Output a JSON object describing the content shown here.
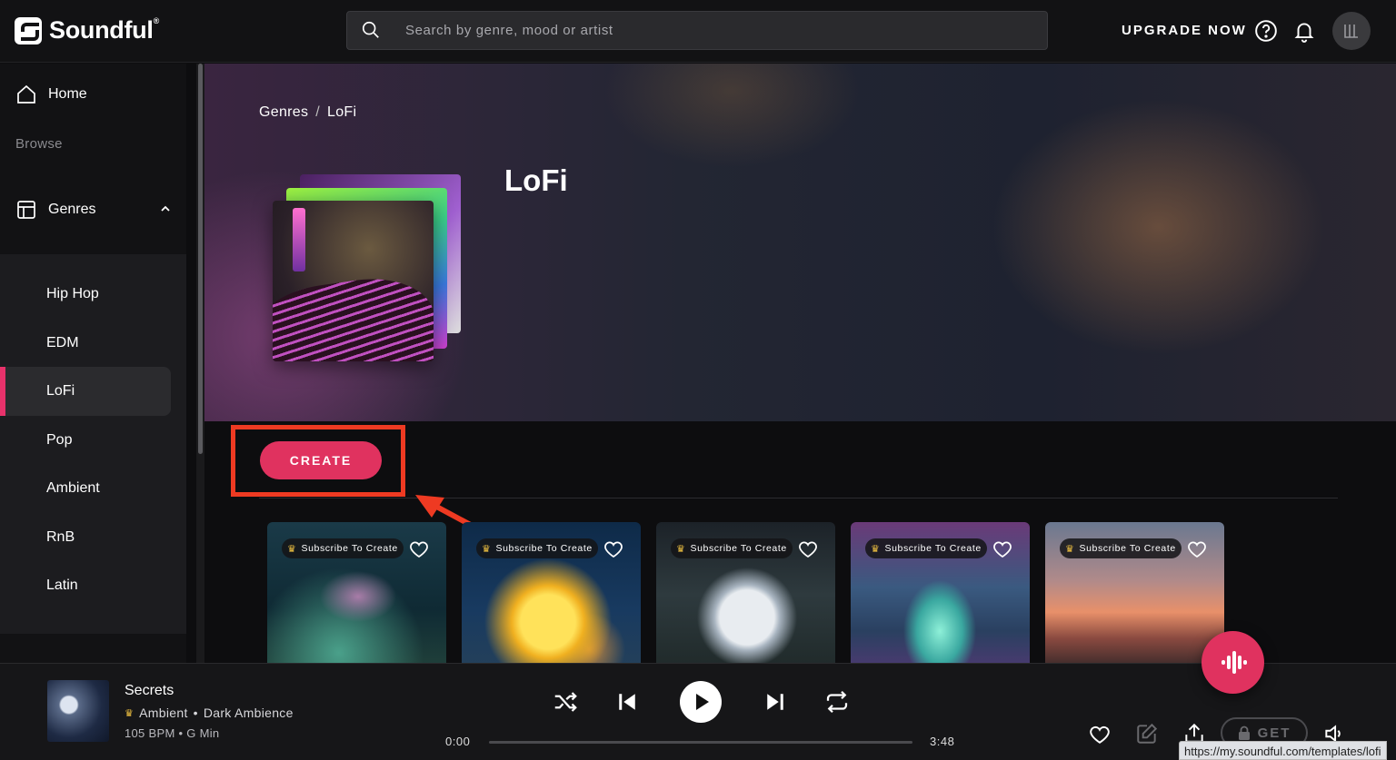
{
  "app": {
    "name": "Soundful"
  },
  "header": {
    "search_placeholder": "Search by genre, mood or artist",
    "upgrade_label": "UPGRADE NOW"
  },
  "sidebar": {
    "home_label": "Home",
    "browse_label": "Browse",
    "genres_label": "Genres",
    "genres": [
      {
        "label": "Hip Hop"
      },
      {
        "label": "EDM"
      },
      {
        "label": "LoFi",
        "active": true
      },
      {
        "label": "Pop"
      },
      {
        "label": "Ambient"
      },
      {
        "label": "RnB"
      },
      {
        "label": "Latin"
      }
    ]
  },
  "page": {
    "breadcrumb": {
      "root": "Genres",
      "separator": "/",
      "current": "LoFi"
    },
    "title": "LoFi",
    "create_label": "CREATE"
  },
  "cards": [
    {
      "badge": "Subscribe To Create",
      "art": "glowing-mushroom"
    },
    {
      "badge": "Subscribe To Create",
      "art": "girl-with-star"
    },
    {
      "badge": "Subscribe To Create",
      "art": "moon-in-forest"
    },
    {
      "badge": "Subscribe To Create",
      "art": "misty-forest"
    },
    {
      "badge": "Subscribe To Create",
      "art": "figure-at-sunset"
    }
  ],
  "player": {
    "title": "Secrets",
    "genre": "Ambient",
    "mood": "Dark Ambience",
    "meta_separator": "•",
    "bpm": "105 BPM",
    "key": "G Min",
    "current_time": "0:00",
    "duration": "3:48",
    "progress_fraction": 0,
    "get_label": "GET"
  },
  "status_url": "https://my.soundful.com/templates/lofi",
  "colors": {
    "accent": "#e0325f",
    "annotation": "#ee3a22"
  }
}
